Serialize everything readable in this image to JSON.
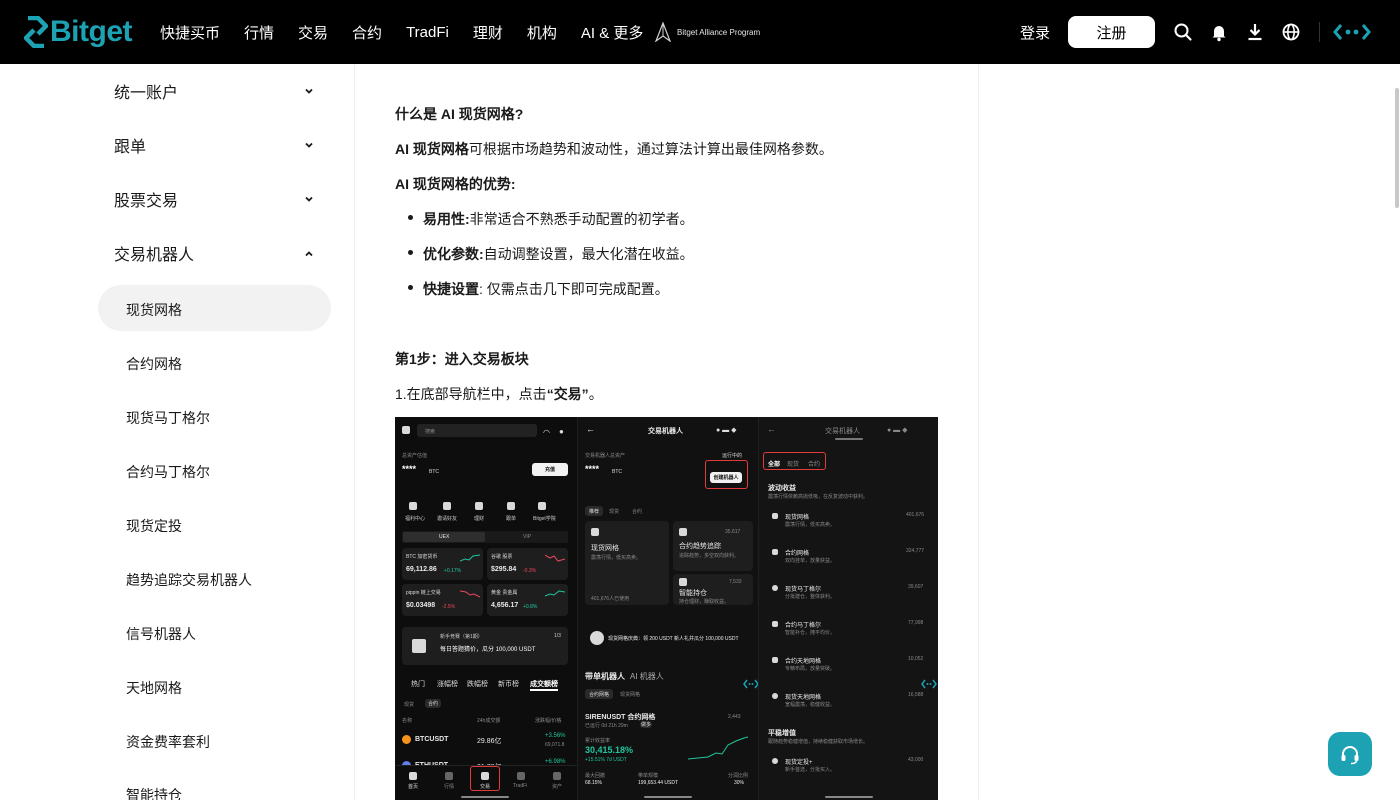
{
  "brand": {
    "name": "Bitget",
    "color": "#1da2b4"
  },
  "nav": {
    "items": [
      "快捷买币",
      "行情",
      "交易",
      "合约",
      "TradFi",
      "理财",
      "机构",
      "AI & 更多"
    ],
    "alliance": "Bitget Alliance Program",
    "login": "登录",
    "register": "注册",
    "icons": [
      "search-icon",
      "bell-icon",
      "download-icon",
      "globe-icon",
      "bitget-mark-icon"
    ]
  },
  "sidebar": {
    "groups": [
      {
        "label": "统一账户",
        "expanded": false
      },
      {
        "label": "跟单",
        "expanded": false
      },
      {
        "label": "股票交易",
        "expanded": false
      },
      {
        "label": "交易机器人",
        "expanded": true
      }
    ],
    "subitems": [
      "现货网格",
      "合约网格",
      "现货马丁格尔",
      "合约马丁格尔",
      "现货定投",
      "趋势追踪交易机器人",
      "信号机器人",
      "天地网格",
      "资金费率套利",
      "智能持仓"
    ],
    "active": "现货网格"
  },
  "article": {
    "q_title": "什么是 AI 现货网格?",
    "intro_bold": "AI 现货网格",
    "intro_rest": "可根据市场趋势和波动性，通过算法计算出最佳网格参数。",
    "adv_title": "AI 现货网格的优势:",
    "advantages": [
      {
        "bold": "易用性:",
        "text": "非常适合不熟悉手动配置的初学者。"
      },
      {
        "bold": "优化参数:",
        "text": "自动调整设置，最大化潜在收益。"
      },
      {
        "bold": "快捷设置",
        "text": ": 仅需点击几下即可完成配置。"
      }
    ],
    "step1_title": "第1步：进入交易板块",
    "step1_pre": "1.在底部导航栏中，点击",
    "step1_bold": "“交易”",
    "step1_post": "。"
  },
  "screenshot": {
    "p1": {
      "search": "搜索",
      "assets_label": "总资产估值",
      "assets_value": "****",
      "assets_unit": "BTC",
      "deposit": "充值",
      "shortcuts": [
        "福利中心",
        "邀请好友",
        "理财",
        "跟单",
        "Bitget学院",
        "更多"
      ],
      "tabs": [
        "UEX",
        "VIP"
      ],
      "tiles": [
        {
          "name": "BTC 加密货币",
          "price": "69,112.86",
          "chg": "+0.17%",
          "up": true
        },
        {
          "name": "谷歌 股票",
          "price": "$295.84",
          "chg": "-0.3%",
          "up": false
        },
        {
          "name": "pippin 链上交易",
          "price": "$0.03498",
          "chg": "-2.5%",
          "up": false
        },
        {
          "name": "黄金 贵金属",
          "price": "4,656.17",
          "chg": "+0.8%",
          "up": true
        }
      ],
      "banner": "每日答题猜价，瓜分 100,000 USDT",
      "banner_tag": "新手竞赛（第1期）",
      "banner_page": "1/3",
      "list_tabs": [
        "热门",
        "涨幅榜",
        "跌幅榜",
        "新币榜",
        "成交额榜"
      ],
      "sub_tabs": [
        "现货",
        "合约"
      ],
      "col_headers": [
        "名称",
        "24h成交额",
        "涨跌幅/价格"
      ],
      "rows": [
        {
          "coin": "BTCUSDT",
          "vol": "29.86亿",
          "chg": "+3.56%",
          "price": "69,071.8"
        },
        {
          "coin": "ETHUSDT",
          "vol": "21.78亿",
          "chg": "+6.98%",
          "price": ""
        }
      ],
      "bottom_nav": [
        "首页",
        "行情",
        "交易",
        "TradFi",
        "资产"
      ]
    },
    "p2": {
      "title": "交易机器人",
      "assets_label": "交易机器人总资产",
      "assets_value": "****",
      "assets_unit": "BTC",
      "running": "运行中的",
      "create": "创建机器人",
      "tabs": [
        "推荐",
        "现货",
        "合约"
      ],
      "bots": [
        {
          "name": "现货网格",
          "desc": "震荡行情，低买高卖。",
          "users": "401,676人已使用"
        },
        {
          "name": "合约趋势追踪",
          "desc": "追踪趋势，多空双向获利。",
          "users": "35,617"
        },
        {
          "name": "智能持仓",
          "desc": "持仓理财，赚取收益。",
          "users": "7,533"
        }
      ],
      "promo": "现货网格庆典：领 200 USDT 新人礼并瓜分 100,000 USDT",
      "section": "带单机器人",
      "section2": "AI 机器人",
      "section_tabs": [
        "合约网格",
        "现货网格"
      ],
      "pair": "SIRENUSDT 合约网格",
      "pair_sub": "已运行 0d 21h 29m",
      "pair_badge": "做多",
      "pair_users": "2,443",
      "roi_label": "累计收益率",
      "roi": "30,415.18%",
      "roi_sub": "+15.51% 7d USDT",
      "stats": [
        {
          "label": "最大回撤",
          "value": "68.15%"
        },
        {
          "label": "带单规模",
          "value": "199,653.44 USDT"
        },
        {
          "label": "分润比例",
          "value": "30%"
        }
      ]
    },
    "p3": {
      "title": "交易机器人",
      "tabs": [
        "全部",
        "现货",
        "合约"
      ],
      "section1": "波动收益",
      "section1_sub": "震荡行情依赖高抛低吸，在反复波动中获利。",
      "bots": [
        {
          "name": "现货网格",
          "desc": "震荡行情，低买高卖。",
          "users": "401,676"
        },
        {
          "name": "合约网格",
          "desc": "双向挂单，放量获益。",
          "users": "324,777"
        },
        {
          "name": "现货马丁格尔",
          "desc": "分批建仓，整体获利。",
          "users": "39,607"
        },
        {
          "name": "合约马丁格尔",
          "desc": "智能补仓，摊平均价。",
          "users": "77,998"
        },
        {
          "name": "合约天地网格",
          "desc": "专精布局，放量突破。",
          "users": "10,052"
        },
        {
          "name": "现货天地网格",
          "desc": "宽幅震荡，稳健收益。",
          "users": "16,588"
        }
      ],
      "section2": "平稳增值",
      "section2_sub": "跟随趋势稳健增值，持续稳健获取市场增长。",
      "bot_last": {
        "name": "现货定投+",
        "desc": "新手首选，分批买入。",
        "users": "43,000"
      }
    }
  }
}
